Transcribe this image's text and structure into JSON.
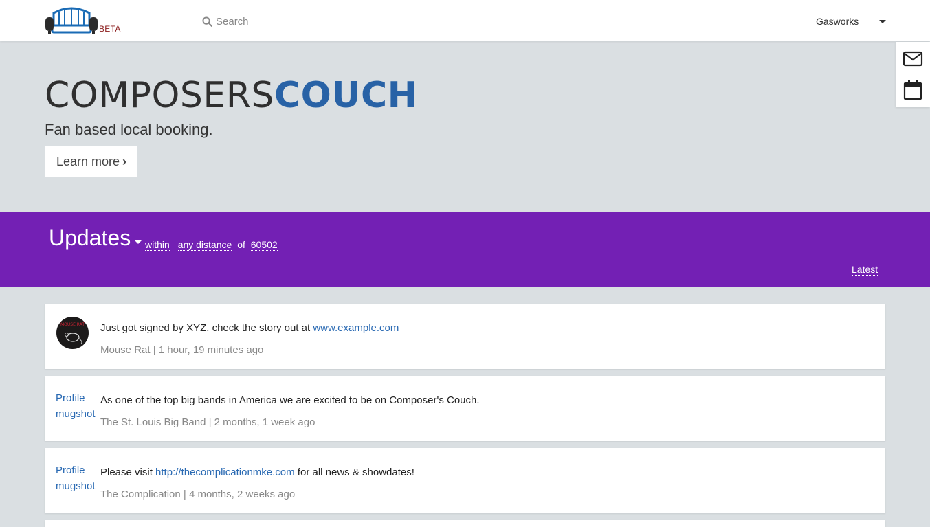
{
  "header": {
    "beta_label": "BETA",
    "search_placeholder": "Search",
    "user_name": "Gasworks"
  },
  "side_tools": [
    "envelope-icon",
    "calendar-icon"
  ],
  "hero": {
    "title_part1": "COMPOSERS",
    "title_part2": "COUCH",
    "tagline": "Fan based local booking.",
    "learn_more": "Learn more"
  },
  "updates": {
    "title": "Updates",
    "within": "within",
    "distance": "any distance",
    "of": "of",
    "zip": "60502",
    "sort": "Latest"
  },
  "feed": [
    {
      "avatar": "Mouse Rat avatar",
      "text_before": "Just got signed by XYZ. check the story out at ",
      "link": "www.example.com",
      "text_after": "",
      "author": "Mouse Rat",
      "time": "1 hour, 19 minutes ago"
    },
    {
      "mugshot": "Profile mugshot",
      "text_before": "As one of the top big bands in America we are excited to be on Composer's Couch.",
      "link": "",
      "text_after": "",
      "author": "The St. Louis Big Band",
      "time": "2 months, 1 week ago"
    },
    {
      "mugshot": "Profile mugshot",
      "text_before": "Please visit ",
      "link": "http://thecomplicationmke.com",
      "text_after": " for all news & showdates!",
      "author": "The Complication",
      "time": "4 months, 2 weeks ago"
    }
  ],
  "colors": {
    "accent_blue": "#2862a6",
    "band_purple": "#7320b4",
    "page_bg": "#dadfe2"
  }
}
